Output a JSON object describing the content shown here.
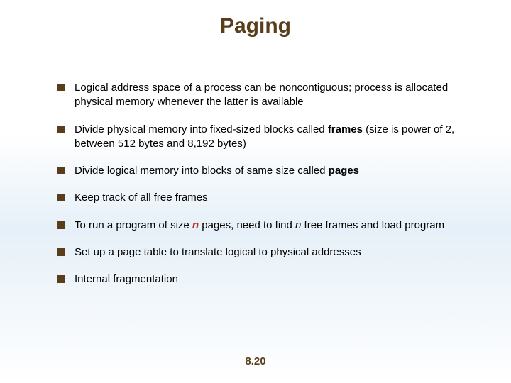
{
  "title": "Paging",
  "bullets": [
    {
      "parts": [
        {
          "text": "Logical address space of a process can be noncontiguous; process is allocated physical memory whenever the latter is available"
        }
      ]
    },
    {
      "parts": [
        {
          "text": "Divide physical memory into fixed-sized blocks called "
        },
        {
          "text": "frames",
          "bold": true
        },
        {
          "text": " (size is power of 2, between 512 bytes and 8,192 bytes)"
        }
      ]
    },
    {
      "parts": [
        {
          "text": "Divide logical memory into blocks of same size called "
        },
        {
          "text": "pages",
          "bold": true
        }
      ]
    },
    {
      "parts": [
        {
          "text": "Keep track of all free frames"
        }
      ]
    },
    {
      "parts": [
        {
          "text": "To run a program of size "
        },
        {
          "text": "n",
          "red": true
        },
        {
          "text": " pages, need to find "
        },
        {
          "text": "n",
          "italic": true
        },
        {
          "text": " free frames and load program"
        }
      ]
    },
    {
      "parts": [
        {
          "text": "Set up a page table to translate logical to physical addresses"
        }
      ]
    },
    {
      "parts": [
        {
          "text": "Internal fragmentation"
        }
      ]
    }
  ],
  "footer": "8.20"
}
